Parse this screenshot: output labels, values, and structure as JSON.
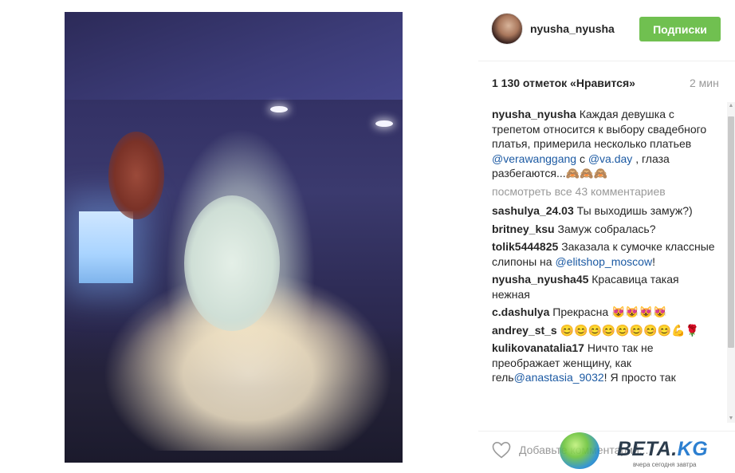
{
  "post": {
    "username": "nyusha_nyusha",
    "follow_label": "Подписки",
    "likes": "1 130 отметок «Нравится»",
    "time": "2 мин",
    "view_all": "посмотреть все 43 комментариев",
    "add_comment_placeholder": "Добавьте комментарий...",
    "accent_color": "#70c050",
    "mention_color": "#1c5aa3"
  },
  "caption": {
    "user": "nyusha_nyusha",
    "text_before": "Каждая девушка с трепетом относится к выбору свадебного платья, примерила несколько платьев ",
    "mention1": "@verawanggang",
    "text_middle": " с ",
    "mention2": "@va.day",
    "text_after": " , глаза разбегаются...🙈🙈🙈"
  },
  "comments": [
    {
      "user": "sashulya_24.03",
      "text": "Ты выходишь замуж?)"
    },
    {
      "user": "britney_ksu",
      "text": "Замуж собралась?"
    },
    {
      "user": "tolik5444825",
      "text": "Заказала к сумочке классные слипоны на ",
      "mention": "@elitshop_moscow",
      "text_after": "!"
    },
    {
      "user": "nyusha_nyusha45",
      "text": "Красавица такая нежная"
    },
    {
      "user": "c.dashulya",
      "text": "Прекрасна 😻😻😻😻"
    },
    {
      "user": "andrey_st_s",
      "text": "😊😊😊😊😊😊😊😊💪🌹"
    },
    {
      "user": "kulikovanatalia17",
      "text": "Ничто так не преображает женщину, как гель",
      "mention": "@anastasia_9032",
      "text_after": "! Я просто так"
    }
  ],
  "watermark": {
    "brand": "BETA.",
    "brand_suffix": "KG",
    "tagline": "вчера сегодня завтра"
  },
  "icons": {
    "like": "heart-outline-icon",
    "avatar": "avatar",
    "globe": "globe-logo-icon"
  }
}
